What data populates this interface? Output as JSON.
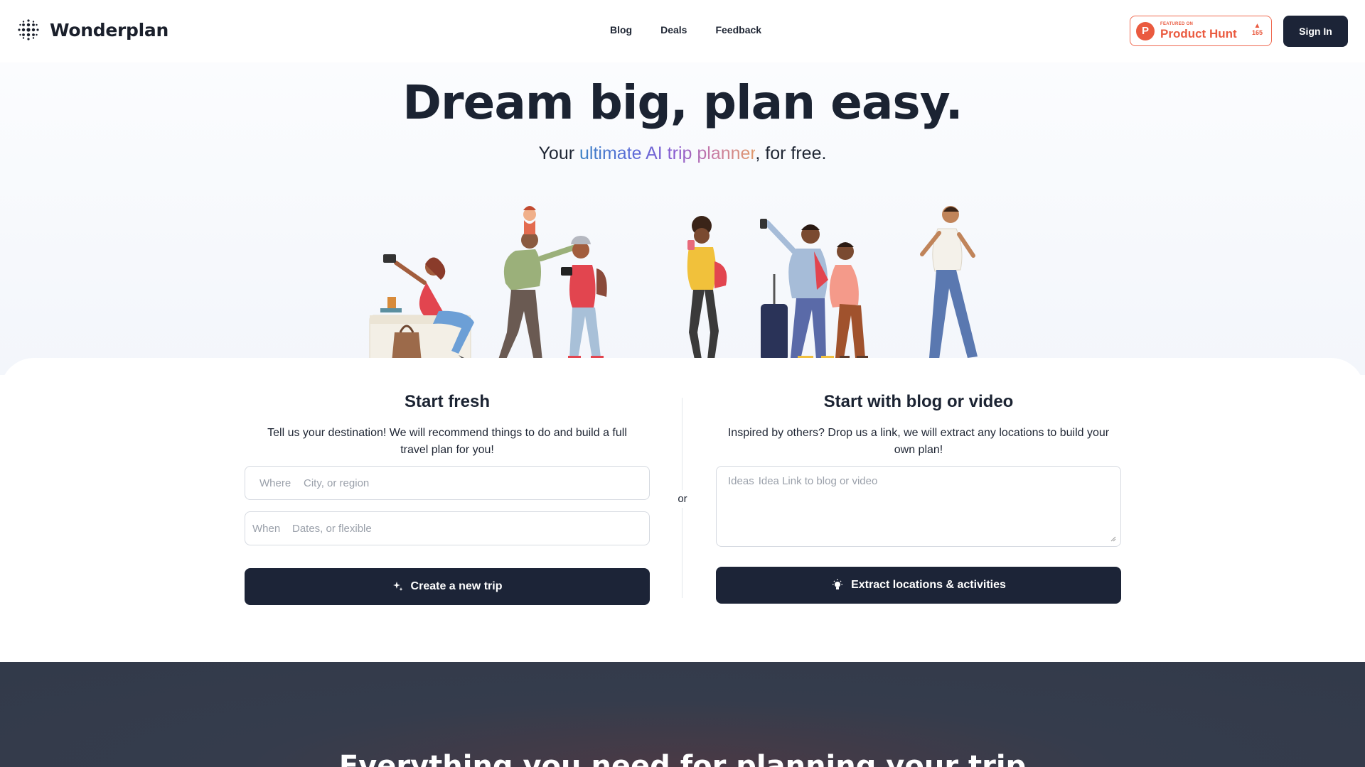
{
  "brand": {
    "name": "Wonderplan"
  },
  "nav": {
    "items": [
      "Blog",
      "Deals",
      "Feedback"
    ]
  },
  "product_hunt": {
    "featured": "FEATURED ON",
    "name": "Product Hunt",
    "votes": "165",
    "letter": "P"
  },
  "header": {
    "signin_label": "Sign In"
  },
  "hero": {
    "title": "Dream big, plan easy.",
    "sub_pre": "Your ",
    "sub_highlight": "ultimate AI trip planner",
    "sub_post": ", for free."
  },
  "fresh": {
    "title": "Start fresh",
    "desc": "Tell us your destination! We will recommend things to do and build a full travel plan for you!",
    "where_label": "Where",
    "where_placeholder": "City, or region",
    "when_label": "When",
    "when_placeholder": "Dates, or flexible",
    "button_label": "Create a new trip"
  },
  "divider": {
    "or": "or"
  },
  "blog": {
    "title": "Start with blog or video",
    "desc": "Inspired by others? Drop us a link, we will extract any locations to build your own plan!",
    "ideas_label": "Ideas",
    "ideas_placeholder": "Idea Link to blog or video",
    "button_label": "Extract locations & activities"
  },
  "features": {
    "title": "Everything you need for planning your trip"
  },
  "colors": {
    "primary": "#1c2437",
    "producthunt": "#ea5a3f"
  }
}
